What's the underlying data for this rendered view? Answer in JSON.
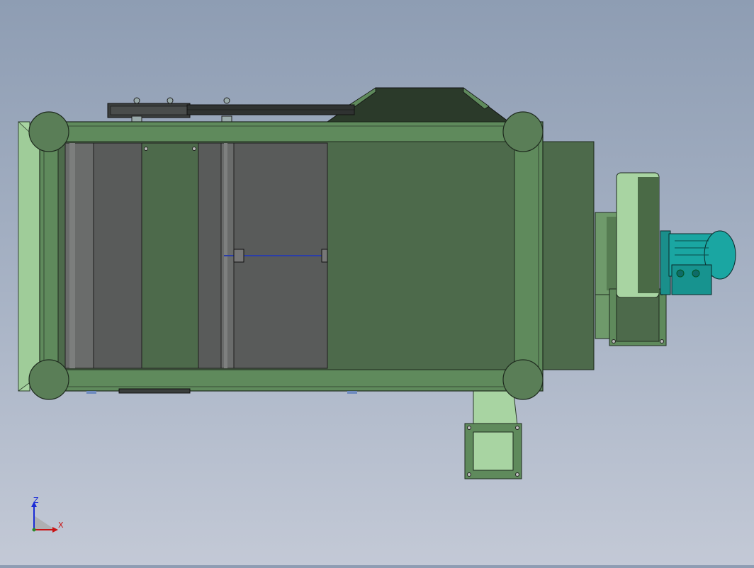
{
  "viewport": {
    "background_top": "#8e9db3",
    "background_bottom": "#c3c9d6",
    "model_colors": {
      "frame_green": "#5f8a5c",
      "panel_green": "#4d6a4b",
      "dark_panel": "#595b5a",
      "light_green": "#a8d4a2",
      "motor_teal": "#1aa6a2",
      "hopper_dark": "#2b3a2a"
    },
    "icons": [
      "machine-assembly",
      "roller",
      "belt-drive",
      "hopper",
      "fan-housing",
      "electric-motor",
      "discharge-chute"
    ]
  },
  "triad": {
    "z_label": "Z",
    "x_label": "X",
    "z_color": "#1a2bd6",
    "x_color": "#c81414"
  }
}
